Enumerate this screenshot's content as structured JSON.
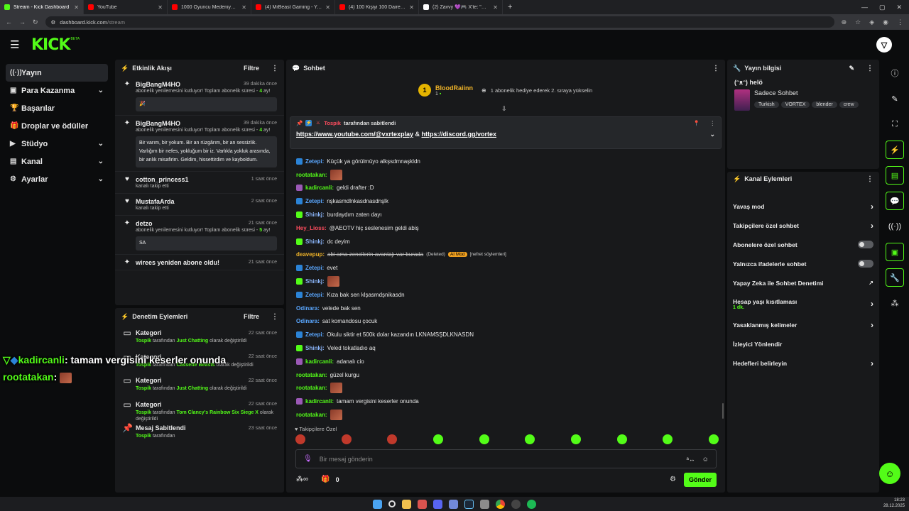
{
  "browser": {
    "tabs": [
      {
        "title": "Stream - Kick Dashboard",
        "color": "#53fc18"
      },
      {
        "title": "YouTube",
        "color": "#ff0000"
      },
      {
        "title": "1000 Oyuncu Medeniyeti Simül",
        "color": "#ff0000"
      },
      {
        "title": "(4) MrBeast Gaming - YouTube",
        "color": "#ff0000"
      },
      {
        "title": "(4) 100 Kişiyi 100 Daireye Nasıl",
        "color": "#ff0000"
      },
      {
        "title": "(2) Zavvy 💜🎮 X'te: \"Bu etkinl",
        "color": "#ffffff"
      }
    ],
    "url_host": "dashboard.kick.com",
    "url_path": "/stream"
  },
  "brand": {
    "logo": "KICK",
    "beta": "BETA",
    "accent": "#53fc18"
  },
  "sidebar": [
    {
      "icon": "broadcast-icon",
      "glyph": "((·))",
      "label": "Yayın",
      "chev": false,
      "active": true
    },
    {
      "icon": "money-icon",
      "glyph": "▣",
      "label": "Para Kazanma",
      "chev": true,
      "active": false
    },
    {
      "icon": "trophy-icon",
      "glyph": "🏆",
      "label": "Başarılar",
      "chev": false,
      "active": false
    },
    {
      "icon": "gift-icon",
      "glyph": "🎁",
      "label": "Droplar ve ödüller",
      "chev": false,
      "active": false
    },
    {
      "icon": "studio-icon",
      "glyph": "▶",
      "label": "Stüdyo",
      "chev": true,
      "active": false
    },
    {
      "icon": "channel-icon",
      "glyph": "▤",
      "label": "Kanal",
      "chev": true,
      "active": false
    },
    {
      "icon": "settings-icon",
      "glyph": "⚙",
      "label": "Ayarlar",
      "chev": true,
      "active": false
    }
  ],
  "activity": {
    "title": "Etkinlik Akışı",
    "filter": "Filtre",
    "items": [
      {
        "name": "BigBangM4HO",
        "time": "39 dakika önce",
        "sub": "abonelik yenilemesini kutluyor! Toplam abonelik süresi - ",
        "months": "4",
        "suffix": " ay!",
        "box": "🎉",
        "icon": "star-icon",
        "glyph": "✦"
      },
      {
        "name": "BigBangM4HO",
        "time": "39 dakika önce",
        "sub": "abonelik yenilemesini kutluyor! Toplam abonelik süresi - ",
        "months": "4",
        "suffix": " ay!",
        "box": "Bir varım, bir yokum. Bir an rüzgârım, bir an sessizlik. Varlığım bir nefes, yokluğum bir iz. Varlıkla yokluk arasında, bir anlık misafirim. Geldim, hissettirdim ve kayboldum.",
        "icon": "star-icon",
        "glyph": "✦"
      },
      {
        "name": "cotton_princess1",
        "time": "1 saat önce",
        "sub": "kanalı takip etti",
        "months": "",
        "suffix": "",
        "box": "",
        "icon": "heart-icon",
        "glyph": "♥"
      },
      {
        "name": "MustafaArda",
        "time": "2 saat önce",
        "sub": "kanalı takip etti",
        "months": "",
        "suffix": "",
        "box": "",
        "icon": "heart-icon",
        "glyph": "♥"
      },
      {
        "name": "detzo",
        "time": "21 saat önce",
        "sub": "abonelik yenilemesini kutluyor! Toplam abonelik süresi - ",
        "months": "5",
        "suffix": " ay!",
        "box": "SA",
        "icon": "star-icon",
        "glyph": "✦"
      },
      {
        "name": "wirees yeniden abone oldu!",
        "time": "21 saat önce",
        "sub": "",
        "months": "",
        "suffix": "",
        "box": "",
        "icon": "star-icon",
        "glyph": "✦"
      }
    ]
  },
  "moderation": {
    "title": "Denetim Eylemleri",
    "filter": "Filtre",
    "items": [
      {
        "title": "Kategori",
        "time": "22 saat önce",
        "user": "Tospik",
        "mid": " tarafından ",
        "target": "Just Chatting",
        "tail": " olarak değiştirildi",
        "icon": "category-icon",
        "glyph": "▭"
      },
      {
        "title": "Kategori",
        "time": "22 saat önce",
        "user": "Tospik",
        "mid": " tarafından ",
        "target": "Cassette Beasts",
        "tail": " olarak değiştirildi",
        "icon": "category-icon",
        "glyph": "▭"
      },
      {
        "title": "Kategori",
        "time": "22 saat önce",
        "user": "Tospik",
        "mid": " tarafından ",
        "target": "Just Chatting",
        "tail": " olarak değiştirildi",
        "icon": "category-icon",
        "glyph": "▭"
      },
      {
        "title": "Kategori",
        "time": "22 saat önce",
        "user": "Tospik",
        "mid": " tarafından ",
        "target": "Tom Clancy's Rainbow Six Siege X",
        "tail": " olarak değiştirildi",
        "icon": "category-icon",
        "glyph": "▭"
      },
      {
        "title": "Mesaj Sabitlendi",
        "time": "23 saat önce",
        "user": "Tospik",
        "mid": " tarafından",
        "target": "",
        "tail": "",
        "icon": "pin-icon",
        "glyph": "📌"
      }
    ]
  },
  "chat": {
    "title": "Sohbet",
    "gift_user": "BloodRaiinn",
    "gift_count": "1",
    "gift_text": "1 abonelik hediye ederek 2. sıraya yükselin",
    "pinned_by": "Tospik",
    "pinned_label": " tarafından sabitlendi",
    "pinned_link1": "https://www.youtube.com/@vxrtexplay",
    "pinned_amp": " & ",
    "pinned_link2": "https://discord.gg/vortex",
    "messages": [
      {
        "user": "Zetepi",
        "color": "#5aa7ff",
        "badge": "#2b83d6",
        "text": "Küçük ya görülmüyo alkşsdmnaşkldn",
        "emote": false,
        "strike": false
      },
      {
        "user": "rootatakan",
        "color": "#53fc18",
        "badge": "",
        "text": "",
        "emote": true,
        "strike": false
      },
      {
        "user": "kadircanli",
        "color": "#53fc18",
        "badge": "#9b59b6",
        "text": "geldi drafter :D",
        "emote": false,
        "strike": false
      },
      {
        "user": "Zetepi",
        "color": "#5aa7ff",
        "badge": "#2b83d6",
        "text": "nşkasmdlnkasdnasdnşlk",
        "emote": false,
        "strike": false
      },
      {
        "user": "Shinkj",
        "color": "#8ab4f8",
        "badge": "#53fc18",
        "text": "burdaydım zaten dayı",
        "emote": false,
        "strike": false
      },
      {
        "user": "Hey_Lioss",
        "color": "#ff4d5e",
        "badge": "",
        "text": "@AEOTV hiç seslenesim geldi abiş",
        "emote": false,
        "strike": false
      },
      {
        "user": "Shinkj",
        "color": "#8ab4f8",
        "badge": "#53fc18",
        "text": "dc deyim",
        "emote": false,
        "strike": false
      },
      {
        "user": "deavepup",
        "color": "#f0b429",
        "badge": "",
        "text": "abi ama zencilerin avantajı var burada",
        "emote": false,
        "strike": true,
        "deleted": "(Deleted)",
        "mod": "AI Mod",
        "reason": "[nefret söylemleri]"
      },
      {
        "user": "Zetepi",
        "color": "#5aa7ff",
        "badge": "#2b83d6",
        "text": "evet",
        "emote": false,
        "strike": false
      },
      {
        "user": "Shinkj",
        "color": "#8ab4f8",
        "badge": "#53fc18",
        "text": "",
        "emote": true,
        "strike": false
      },
      {
        "user": "Zetepi",
        "color": "#5aa7ff",
        "badge": "#2b83d6",
        "text": "Kıza bak sen klşasmdşnikasdn",
        "emote": false,
        "strike": false
      },
      {
        "user": "Odinara",
        "color": "#5aa7ff",
        "badge": "",
        "text": "velede bak sen",
        "emote": false,
        "strike": false
      },
      {
        "user": "Odinara",
        "color": "#5aa7ff",
        "badge": "",
        "text": "sat komandosu çocuk",
        "emote": false,
        "strike": false
      },
      {
        "user": "Zetepi",
        "color": "#5aa7ff",
        "badge": "#2b83d6",
        "text": "Okulu siktir et 500k dolar kazandın LKNAMSŞDLKNASDN",
        "emote": false,
        "strike": false
      },
      {
        "user": "Shinkj",
        "color": "#8ab4f8",
        "badge": "#53fc18",
        "text": "Veled tokatladıo aq",
        "emote": false,
        "strike": false
      },
      {
        "user": "kadircanli",
        "color": "#53fc18",
        "badge": "#9b59b6",
        "text": "adanalı cio",
        "emote": false,
        "strike": false
      },
      {
        "user": "rootatakan",
        "color": "#53fc18",
        "badge": "",
        "text": "güzel kurgu",
        "emote": false,
        "strike": false
      },
      {
        "user": "rootatakan",
        "color": "#53fc18",
        "badge": "",
        "text": "",
        "emote": true,
        "strike": false
      },
      {
        "user": "kadircanli",
        "color": "#53fc18",
        "badge": "#9b59b6",
        "text": "tamam vergisini keserler onunda",
        "emote": false,
        "strike": false
      },
      {
        "user": "rootatakan",
        "color": "#53fc18",
        "badge": "",
        "text": "",
        "emote": true,
        "strike": false
      }
    ],
    "followers_only": "♥ Takipçilere Özel",
    "input_placeholder": "Bir mesaj gönderin",
    "points": "0",
    "send": "Gönder"
  },
  "stream_info": {
    "title": "Yayın bilgisi",
    "stream_title": "(ᵔᴥᵔ) helö",
    "category": "Sadece Sohbet",
    "tags": [
      "Turkish",
      "VORTEX",
      "blender",
      "crew"
    ]
  },
  "channel_actions": {
    "title": "Kanal Eylemleri",
    "items": [
      {
        "label": "Yavaş mod",
        "type": "chev",
        "sub": ""
      },
      {
        "label": "Takipçilere özel sohbet",
        "type": "chev",
        "sub": ""
      },
      {
        "label": "Abonelere özel sohbet",
        "type": "toggle",
        "sub": ""
      },
      {
        "label": "Yalnızca ifadelerle sohbet",
        "type": "toggle",
        "sub": ""
      },
      {
        "label": "Yapay Zeka ile Sohbet Denetimi",
        "type": "ext",
        "sub": ""
      },
      {
        "label": "Hesap yaşı kısıtlaması",
        "type": "chev",
        "sub": "1 dk."
      },
      {
        "label": "Yasaklanmış kelimeler",
        "type": "chev",
        "sub": ""
      },
      {
        "label": "İzleyici Yönlendir",
        "type": "none",
        "sub": ""
      },
      {
        "label": "Hedefleri belirleyin",
        "type": "chev",
        "sub": ""
      }
    ]
  },
  "overlay": {
    "line1_user": "kadircanli",
    "line1_text": ": tamam vergisini keserler onunda",
    "line2_user": "rootatakan",
    "line2_sep": ":"
  },
  "taskbar": {
    "time": "18:23",
    "date": "28.12.2025"
  }
}
